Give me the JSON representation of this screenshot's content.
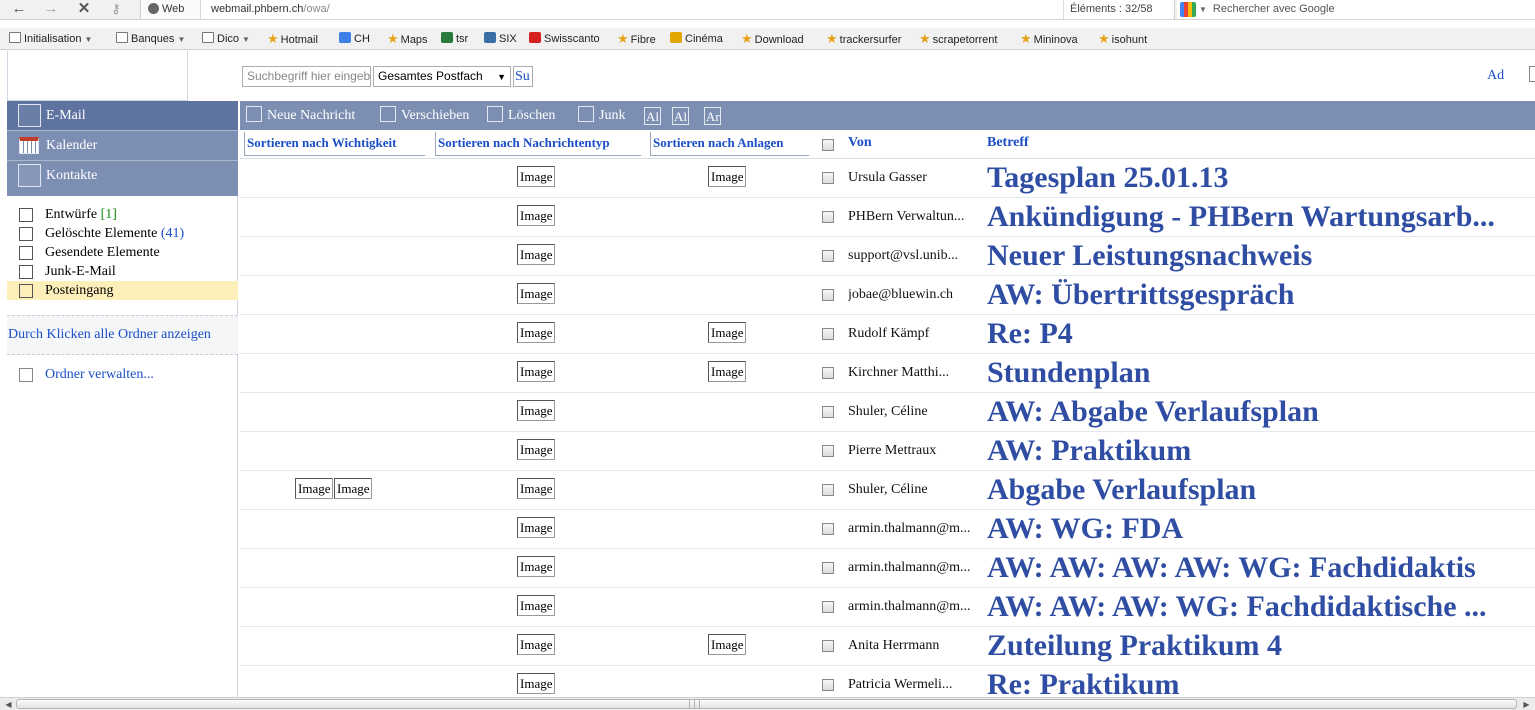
{
  "browser": {
    "back_icon": "back-arrow-icon",
    "forward_icon": "forward-arrow-icon",
    "close_icon": "close-icon",
    "key_icon": "key-icon",
    "web_chip": "Web",
    "url_host": "webmail.phbern.ch",
    "url_path": "/owa/",
    "find_status": "Éléments :    32/58",
    "search_placeholder": "Rechercher avec Google"
  },
  "bookmarks": [
    {
      "label": "Initialisation",
      "icon": "folder-icon",
      "dropdown": true
    },
    {
      "label": "Banques",
      "icon": "folder-icon",
      "dropdown": true
    },
    {
      "label": "Dico",
      "icon": "folder-icon",
      "dropdown": true
    },
    {
      "label": "Hotmail",
      "icon": "star-icon"
    },
    {
      "label": "CH",
      "icon": "google-icon"
    },
    {
      "label": "Maps",
      "icon": "star-icon"
    },
    {
      "label": "tsr",
      "icon": "tsr-icon"
    },
    {
      "label": "SIX",
      "icon": "six-icon"
    },
    {
      "label": "Swisscanto",
      "icon": "swisscanto-icon"
    },
    {
      "label": "Fibre",
      "icon": "star-icon"
    },
    {
      "label": "Cinéma",
      "icon": "cinema-icon"
    },
    {
      "label": "Download",
      "icon": "star-icon"
    },
    {
      "label": "trackersurfer",
      "icon": "star-icon"
    },
    {
      "label": "scrapetorrent",
      "icon": "star-icon"
    },
    {
      "label": "Mininova",
      "icon": "star-icon"
    },
    {
      "label": "isohunt",
      "icon": "star-icon"
    }
  ],
  "owa_header": {
    "search_placeholder": "Suchbegriff hier eingeben",
    "scope_value": "Gesamtes Postfach",
    "search_button": "Su",
    "top_right_link": "Ad"
  },
  "modules": [
    {
      "label": "E-Mail",
      "active": true
    },
    {
      "label": "Kalender",
      "active": false
    },
    {
      "label": "Kontakte",
      "active": false
    }
  ],
  "folders": [
    {
      "label": "Entwürfe",
      "count": "[1]",
      "count_color": "#118a11"
    },
    {
      "label": "Gelöschte Elemente",
      "count": "(41)",
      "count_color": "#1b4ec7"
    },
    {
      "label": "Gesendete Elemente",
      "count": ""
    },
    {
      "label": "Junk-E-Mail",
      "count": ""
    },
    {
      "label": "Posteingang",
      "count": "",
      "selected": true
    }
  ],
  "show_all_folders": "Durch Klicken alle Ordner anzeigen",
  "manage_folders": "Ordner verwalten...",
  "toolbar": {
    "new_message": "Neue Nachricht",
    "move": "Verschieben",
    "delete": "Löschen",
    "junk": "Junk",
    "mini1": "Al",
    "mini2": "Al",
    "mini3": "Ar"
  },
  "sort": {
    "importance": "Sortieren nach Wichtigkeit",
    "type": "Sortieren nach Nachrichtentyp",
    "attachments": "Sortieren nach Anlagen",
    "from_header": "Von",
    "subject_header": "Betreff"
  },
  "image_placeholder": "Image",
  "messages": [
    {
      "from": "Ursula Gasser",
      "subject": "Tagesplan 25.01.13",
      "type_img": true,
      "attach_img": true,
      "importance_imgs": 0
    },
    {
      "from": "PHBern Verwaltun...",
      "subject": "Ankündigung - PHBern Wartungsarb...",
      "type_img": true,
      "attach_img": false,
      "importance_imgs": 0
    },
    {
      "from": "support@vsl.unib...",
      "subject": "Neuer Leistungsnachweis",
      "type_img": true,
      "attach_img": false,
      "importance_imgs": 0
    },
    {
      "from": "jobae@bluewin.ch",
      "subject": "AW: Übertrittsgespräch",
      "type_img": true,
      "attach_img": false,
      "importance_imgs": 0
    },
    {
      "from": "Rudolf Kämpf",
      "subject": "Re: P4",
      "type_img": true,
      "attach_img": true,
      "importance_imgs": 0
    },
    {
      "from": "Kirchner Matthi...",
      "subject": "Stundenplan",
      "type_img": true,
      "attach_img": true,
      "importance_imgs": 0
    },
    {
      "from": "Shuler, Céline",
      "subject": "AW: Abgabe Verlaufsplan",
      "type_img": true,
      "attach_img": false,
      "importance_imgs": 0
    },
    {
      "from": "Pierre Mettraux",
      "subject": "AW: Praktikum",
      "type_img": true,
      "attach_img": false,
      "importance_imgs": 0
    },
    {
      "from": "Shuler, Céline",
      "subject": "Abgabe Verlaufsplan",
      "type_img": true,
      "attach_img": false,
      "importance_imgs": 2
    },
    {
      "from": "armin.thalmann@m...",
      "subject": "AW: WG: FDA",
      "type_img": true,
      "attach_img": false,
      "importance_imgs": 0
    },
    {
      "from": "armin.thalmann@m...",
      "subject": "AW: AW: AW: AW: WG: Fachdidaktis",
      "type_img": true,
      "attach_img": false,
      "importance_imgs": 0
    },
    {
      "from": "armin.thalmann@m...",
      "subject": "AW: AW: AW: WG: Fachdidaktische ...",
      "type_img": true,
      "attach_img": false,
      "importance_imgs": 0
    },
    {
      "from": "Anita Herrmann",
      "subject": "Zuteilung Praktikum 4",
      "type_img": true,
      "attach_img": true,
      "importance_imgs": 0
    },
    {
      "from": "Patricia Wermeli...",
      "subject": "Re: Praktikum",
      "type_img": true,
      "attach_img": false,
      "importance_imgs": 0
    }
  ],
  "colors": {
    "nav_blue": "#7c8fb3",
    "link_blue": "#1b4ec7",
    "subject_blue": "#2e4da3",
    "selected_folder": "#fcefb9"
  }
}
